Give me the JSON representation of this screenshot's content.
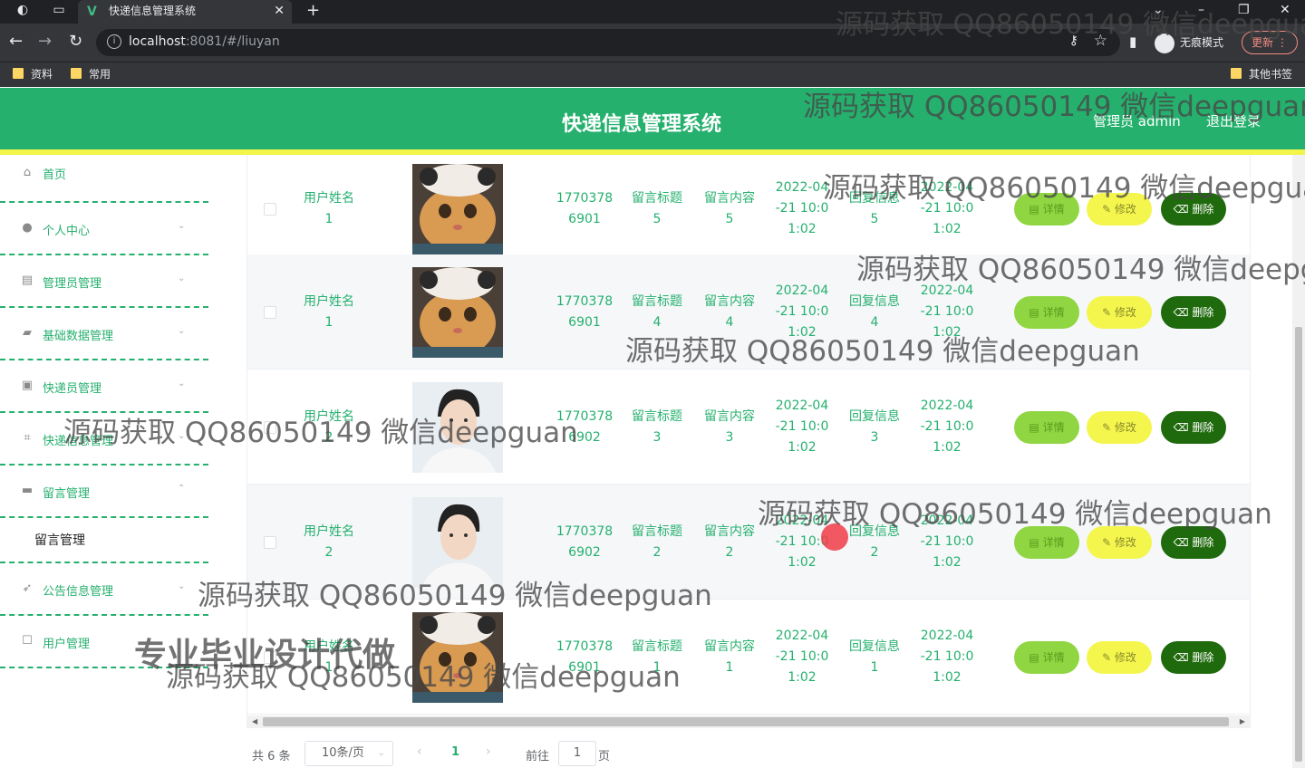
{
  "browser": {
    "tab_title": "快递信息管理系统",
    "tab_logo": "V",
    "url_host": "localhost",
    "url_path": ":8081/#/liuyan",
    "incognito_label": "无痕模式",
    "update_label": "更新",
    "bookmarks": [
      "资料",
      "常用"
    ],
    "other_bookmarks": "其他书签"
  },
  "header": {
    "title": "快递信息管理系统",
    "admin_label": "管理员 admin",
    "logout_label": "退出登录",
    "accent": "#26b06e",
    "stripe": "#f2f54a"
  },
  "sidebar": {
    "items": [
      {
        "label": "首页",
        "icon": "home-icon"
      },
      {
        "label": "个人中心",
        "icon": "user-icon"
      },
      {
        "label": "管理员管理",
        "icon": "clipboard-icon"
      },
      {
        "label": "基础数据管理",
        "icon": "camera-icon"
      },
      {
        "label": "快递员管理",
        "icon": "truck-icon"
      },
      {
        "label": "快递信息管理",
        "icon": "crop-icon"
      },
      {
        "label": "留言管理",
        "icon": "message-icon"
      },
      {
        "label": "公告信息管理",
        "icon": "send-icon"
      },
      {
        "label": "用户管理",
        "icon": "chat-icon"
      }
    ],
    "submenu": "留言管理"
  },
  "table": {
    "rows": [
      {
        "name": "用户姓名\n1",
        "phone": "1770378\n6901",
        "title": "留言标题\n5",
        "content": "留言内容\n5",
        "time": "2022-04\n-21 10:0\n1:02",
        "reply": "回复信息\n5",
        "reply_time": "2022-04\n-21 10:0\n1:02",
        "avatar": "cat"
      },
      {
        "name": "用户姓名\n1",
        "phone": "1770378\n6901",
        "title": "留言标题\n4",
        "content": "留言内容\n4",
        "time": "2022-04\n-21 10:0\n1:02",
        "reply": "回复信息\n4",
        "reply_time": "2022-04\n-21 10:0\n1:02",
        "avatar": "cat"
      },
      {
        "name": "用户姓名\n2",
        "phone": "1770378\n6902",
        "title": "留言标题\n3",
        "content": "留言内容\n3",
        "time": "2022-04\n-21 10:0\n1:02",
        "reply": "回复信息\n3",
        "reply_time": "2022-04\n-21 10:0\n1:02",
        "avatar": "man"
      },
      {
        "name": "用户姓名\n2",
        "phone": "1770378\n6902",
        "title": "留言标题\n2",
        "content": "留言内容\n2",
        "time": "2022-04\n-21 10:0\n1:02",
        "reply": "回复信息\n2",
        "reply_time": "2022-04\n-21 10:0\n1:02",
        "avatar": "man"
      },
      {
        "name": "用户姓名\n1",
        "phone": "1770378\n6901",
        "title": "留言标题\n1",
        "content": "留言内容\n1",
        "time": "2022-04\n-21 10:0\n1:02",
        "reply": "回复信息\n1",
        "reply_time": "2022-04\n-21 10:0\n1:02",
        "avatar": "cat"
      }
    ],
    "buttons": {
      "detail": "详情",
      "edit": "修改",
      "delete": "删除"
    }
  },
  "pager": {
    "total": "共 6 条",
    "page_size": "10条/页",
    "current": "1",
    "goto_label": "前往",
    "goto_value": "1",
    "page_suffix": "页"
  },
  "watermarks": {
    "repeat": "源码获取 QQ86050149 微信deepguan",
    "partial_a": "源码获取 QQ86050149 微信deepgua",
    "partial_b": "源码获取 QQ86050149 微信deepgu",
    "partial_c": "源码获取 QQ86050149 微信deepguan",
    "slogan": "专业毕业设计代做"
  }
}
